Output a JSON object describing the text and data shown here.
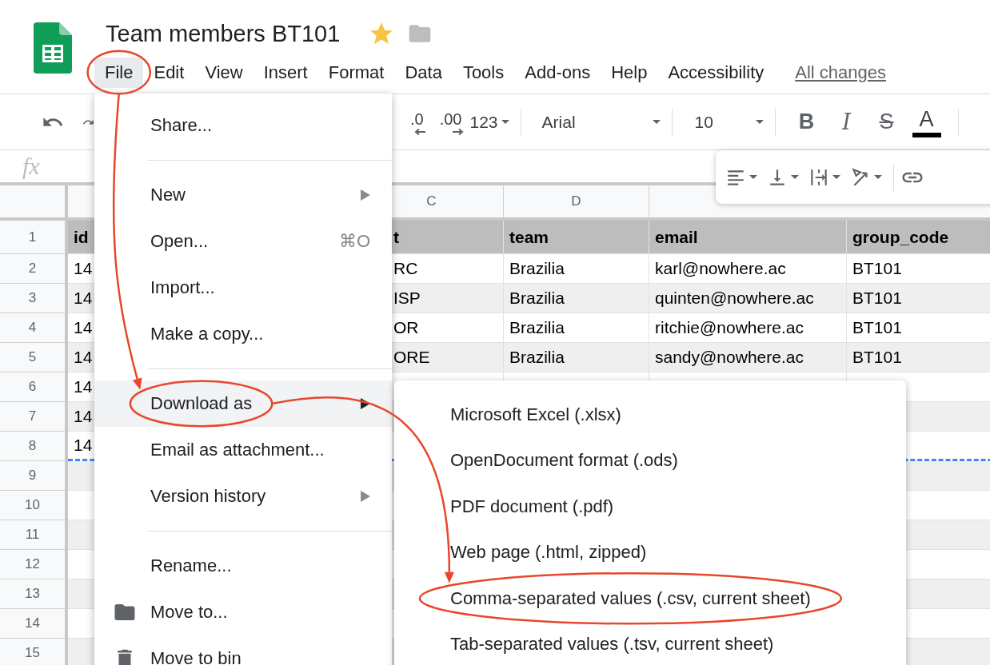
{
  "document": {
    "title": "Team members BT101",
    "starred": true
  },
  "menubar": {
    "items": [
      {
        "label": "File",
        "selected": true,
        "circled": true
      },
      {
        "label": "Edit",
        "selected": false
      },
      {
        "label": "View",
        "selected": false
      },
      {
        "label": "Insert",
        "selected": false
      },
      {
        "label": "Format",
        "selected": false
      },
      {
        "label": "Data",
        "selected": false
      },
      {
        "label": "Tools",
        "selected": false
      },
      {
        "label": "Add-ons",
        "selected": false
      },
      {
        "label": "Help",
        "selected": false
      },
      {
        "label": "Accessibility",
        "selected": false
      }
    ],
    "save_status": "All changes"
  },
  "toolbar": {
    "decimal_decrease": ".0",
    "decimal_increase": ".00",
    "number_format": "123",
    "font": "Arial",
    "font_size": "10",
    "format_buttons": [
      {
        "kind": "bold",
        "glyph": "B"
      },
      {
        "kind": "italic",
        "glyph": "I"
      },
      {
        "kind": "strike",
        "glyph": "S"
      },
      {
        "kind": "color",
        "glyph": "A"
      }
    ]
  },
  "formula_bar": {
    "label": "fx"
  },
  "sheet": {
    "column_headers": {
      "C": "C",
      "D": "D"
    },
    "rows": [
      {
        "number": "1",
        "header": true,
        "banded": false,
        "A": "id",
        "C": "t",
        "D": "team",
        "E": "email",
        "F": "group_code"
      },
      {
        "number": "2",
        "header": false,
        "banded": false,
        "A": "14",
        "C": "RC",
        "D": "Brazilia",
        "E": "karl@nowhere.ac",
        "F": "BT101"
      },
      {
        "number": "3",
        "header": false,
        "banded": true,
        "A": "14",
        "C": "ISP",
        "D": "Brazilia",
        "E": "quinten@nowhere.ac",
        "F": "BT101"
      },
      {
        "number": "4",
        "header": false,
        "banded": false,
        "A": "14",
        "C": "OR",
        "D": "Brazilia",
        "E": "ritchie@nowhere.ac",
        "F": "BT101"
      },
      {
        "number": "5",
        "header": false,
        "banded": true,
        "A": "14",
        "C": "ORE",
        "D": "Brazilia",
        "E": "sandy@nowhere.ac",
        "F": "BT101"
      },
      {
        "number": "6",
        "header": false,
        "banded": false,
        "A": "14"
      },
      {
        "number": "7",
        "header": false,
        "banded": true,
        "A": "14"
      },
      {
        "number": "8",
        "header": false,
        "banded": false,
        "A": "14",
        "copy_outline": true
      },
      {
        "number": "9",
        "header": false,
        "banded": true
      },
      {
        "number": "10",
        "header": false,
        "banded": false
      },
      {
        "number": "11",
        "header": false,
        "banded": true
      },
      {
        "number": "12",
        "header": false,
        "banded": false
      },
      {
        "number": "13",
        "header": false,
        "banded": true
      },
      {
        "number": "14",
        "header": false,
        "banded": false
      },
      {
        "number": "15",
        "header": false,
        "banded": true
      }
    ]
  },
  "file_menu": {
    "items": [
      {
        "kind": "item",
        "label": "Share...",
        "selected": false
      },
      {
        "kind": "separator"
      },
      {
        "kind": "item",
        "label": "New",
        "submenu": true,
        "selected": false
      },
      {
        "kind": "item",
        "label": "Open...",
        "shortcut": "⌘O",
        "selected": false
      },
      {
        "kind": "item",
        "label": "Import...",
        "selected": false
      },
      {
        "kind": "item",
        "label": "Make a copy...",
        "selected": false
      },
      {
        "kind": "separator"
      },
      {
        "kind": "item",
        "label": "Download as",
        "submenu": true,
        "selected": true,
        "circled": true
      },
      {
        "kind": "item",
        "label": "Email as attachment...",
        "selected": false
      },
      {
        "kind": "item",
        "label": "Version history",
        "submenu": true,
        "selected": false
      },
      {
        "kind": "separator"
      },
      {
        "kind": "item",
        "label": "Rename...",
        "selected": false
      },
      {
        "kind": "item",
        "label": "Move to...",
        "selected": false
      },
      {
        "kind": "item",
        "label": "Move to bin",
        "selected": false
      }
    ]
  },
  "download_submenu": {
    "items": [
      {
        "label": "Microsoft Excel (.xlsx)"
      },
      {
        "label": "OpenDocument format (.ods)"
      },
      {
        "label": "PDF document (.pdf)"
      },
      {
        "label": "Web page (.html, zipped)"
      },
      {
        "label": "Comma-separated values (.csv, current sheet)",
        "circled": true
      },
      {
        "label": "Tab-separated values (.tsv, current sheet)"
      }
    ]
  }
}
